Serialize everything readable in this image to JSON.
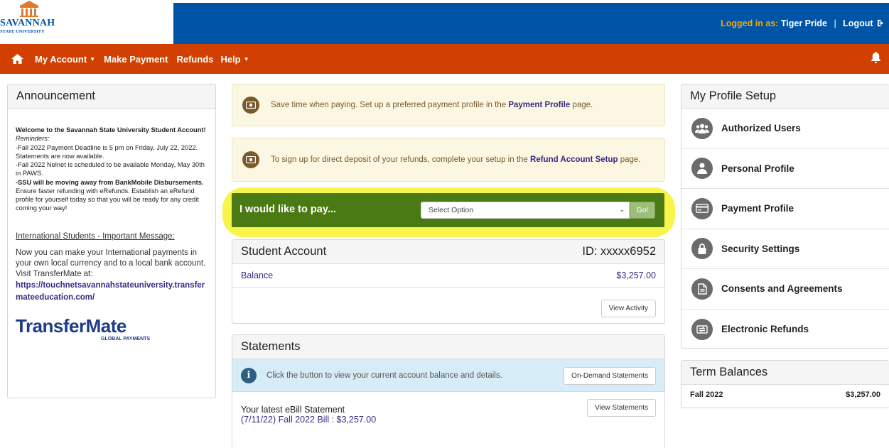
{
  "header": {
    "logo_line1": "SAVANNAH",
    "logo_line2": "STATE UNIVERSITY",
    "logged_in_label": "Logged in as:",
    "user_name": "Tiger Pride",
    "separator": "|",
    "logout_label": "Logout"
  },
  "nav": {
    "my_account": "My Account",
    "make_payment": "Make Payment",
    "refunds": "Refunds",
    "help": "Help"
  },
  "announcement": {
    "title": "Announcement",
    "welcome": "Welcome to the Savannah State University Student Account!",
    "reminders": "Reminders:",
    "line1": "-Fall 2022 Payment Deadline is 5 pm on Friday, July 22, 2022. Statements are now available.",
    "line2": "-Fall 2022 Nelnet is scheduled to be available Monday, May 30th in PAWS.",
    "ssu_bold": "-SSU will be moving away from BankMobile Disbursements.",
    "ssu_rest": " Ensure faster refunding with eRefunds. Establish an eRefund profile for yourself today so that you will be ready for any credit coming your way!",
    "intl_title": "International Students - Important Message:",
    "intl_text": "Now you can make your International payments in your own local currency and to a local bank account.",
    "visit": "Visit TransferMate at:",
    "link": "https://touchnetsavannahstateuniversity.transfermateeducation.com/",
    "tm_logo": "TransferMate",
    "tm_sub": "GLOBAL PAYMENTS"
  },
  "alerts": {
    "payment_profile_pre": "Save time when paying. Set up a preferred payment profile in the ",
    "payment_profile_link": "Payment Profile",
    "payment_profile_post": " page.",
    "refund_pre": "To sign up for direct deposit of your refunds, complete your setup in the ",
    "refund_link": "Refund Account Setup",
    "refund_post": " page."
  },
  "pay": {
    "label": "I would like to pay...",
    "select_value": "Select Option",
    "go_label": "Go!"
  },
  "student_account": {
    "title": "Student Account",
    "id": "ID: xxxxx6952",
    "balance_label": "Balance",
    "balance_value": "$3,257.00",
    "view_activity": "View Activity"
  },
  "statements": {
    "title": "Statements",
    "info_text": "Click the button to view your current account balance and details.",
    "on_demand": "On-Demand Statements",
    "latest_title": "Your latest eBill Statement",
    "latest_link": "(7/11/22) Fall 2022 Bill :   $3,257.00",
    "view_statements": "View Statements"
  },
  "profile_setup": {
    "title": "My Profile Setup",
    "items": [
      {
        "label": "Authorized Users",
        "icon": "users-icon"
      },
      {
        "label": "Personal Profile",
        "icon": "person-icon"
      },
      {
        "label": "Payment Profile",
        "icon": "credit-card-icon"
      },
      {
        "label": "Security Settings",
        "icon": "lock-icon"
      },
      {
        "label": "Consents and Agreements",
        "icon": "document-icon"
      },
      {
        "label": "Electronic Refunds",
        "icon": "refund-exchange-icon"
      }
    ]
  },
  "term_balances": {
    "title": "Term Balances",
    "term": "Fall 2022",
    "amount": "$3,257.00"
  },
  "colors": {
    "header_blue": "#0054a6",
    "nav_orange": "#d14000",
    "pay_green": "#4a7a14",
    "highlight_yellow": "#f8f54a",
    "link_purple": "#3b2a85"
  }
}
